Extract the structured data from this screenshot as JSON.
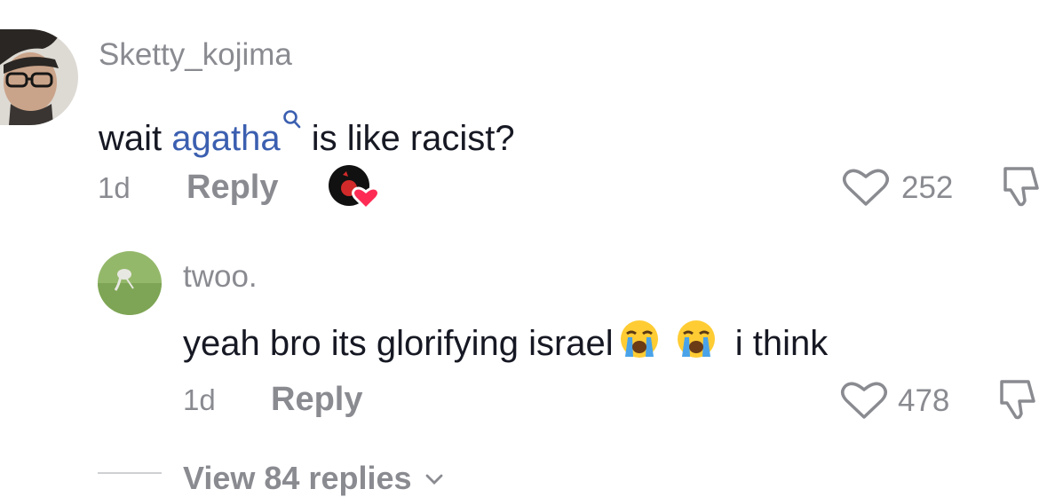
{
  "comments": [
    {
      "username": "Sketty_kojima",
      "text_before": "wait ",
      "mention": "agatha",
      "text_after": " is like racist?",
      "time": "1d",
      "reply_label": "Reply",
      "likes": "252"
    },
    {
      "username": "twoo.",
      "text_before": "yeah bro its glorifying israel",
      "emojis": [
        "loudly-crying-face",
        "loudly-crying-face"
      ],
      "text_after": " i think",
      "time": "1d",
      "reply_label": "Reply",
      "likes": "478"
    }
  ],
  "view_replies_label": "View 84 replies",
  "colors": {
    "mention": "#3b5fb0",
    "muted": "#8a8b91",
    "text": "#161823",
    "creator_heart": "#fe2c55"
  }
}
